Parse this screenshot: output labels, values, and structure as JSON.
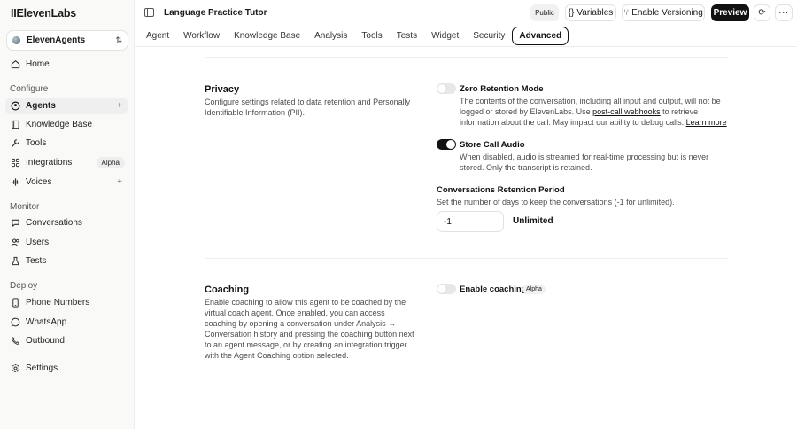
{
  "brand": {
    "logo_text": "IIElevenLabs"
  },
  "workspace": {
    "name": "ElevenAgents"
  },
  "sidebar": {
    "home": "Home",
    "sections": {
      "configure": "Configure",
      "monitor": "Monitor",
      "deploy": "Deploy"
    },
    "configure_items": [
      {
        "label": "Agents",
        "icon": "agents-icon",
        "active": true,
        "plus": "+"
      },
      {
        "label": "Knowledge Base",
        "icon": "book-icon"
      },
      {
        "label": "Tools",
        "icon": "wrench-icon"
      },
      {
        "label": "Integrations",
        "icon": "grid-icon",
        "badge": "Alpha"
      },
      {
        "label": "Voices",
        "icon": "voices-icon",
        "plus": "+"
      }
    ],
    "monitor_items": [
      {
        "label": "Conversations",
        "icon": "chat-icon"
      },
      {
        "label": "Users",
        "icon": "users-icon"
      },
      {
        "label": "Tests",
        "icon": "flask-icon"
      }
    ],
    "deploy_items": [
      {
        "label": "Phone Numbers",
        "icon": "phone-icon"
      },
      {
        "label": "WhatsApp",
        "icon": "whatsapp-icon"
      },
      {
        "label": "Outbound",
        "icon": "outbound-icon"
      }
    ],
    "settings": "Settings"
  },
  "topbar": {
    "agent_name": "Language Practice Tutor",
    "public_label": "Public",
    "variables_label": "Variables",
    "versioning_label": "Enable Versioning",
    "preview_label": "Preview"
  },
  "tabs": [
    "Agent",
    "Workflow",
    "Knowledge Base",
    "Analysis",
    "Tools",
    "Tests",
    "Widget",
    "Security",
    "Advanced"
  ],
  "active_tab": "Advanced",
  "privacy": {
    "title": "Privacy",
    "description": "Configure settings related to data retention and Personally Identifiable Information (PII).",
    "zero_retention": {
      "label": "Zero Retention Mode",
      "enabled": false,
      "text_before": "The contents of the conversation, including all input and output, will not be logged or stored by ElevenLabs. Use ",
      "link_text": "post-call webhooks",
      "text_after": " to retrieve information about the call. May impact our ability to debug calls. ",
      "learn_more": "Learn more"
    },
    "store_audio": {
      "label": "Store Call Audio",
      "enabled": true,
      "description": "When disabled, audio is streamed for real-time processing but is never stored. Only the transcript is retained."
    },
    "retention_period": {
      "label": "Conversations Retention Period",
      "description": "Set the number of days to keep the conversations (-1 for unlimited).",
      "value": "-1",
      "value_label": "Unlimited"
    }
  },
  "coaching": {
    "title": "Coaching",
    "description": "Enable coaching to allow this agent to be coached by the virtual coach agent. Once enabled, you can access coaching by opening a conversation under Analysis → Conversation history and pressing the coaching button next to an agent message, or by creating an integration trigger with the Agent Coaching option selected.",
    "toggle_label": "Enable coaching",
    "enabled": false,
    "badge": "Alpha"
  }
}
